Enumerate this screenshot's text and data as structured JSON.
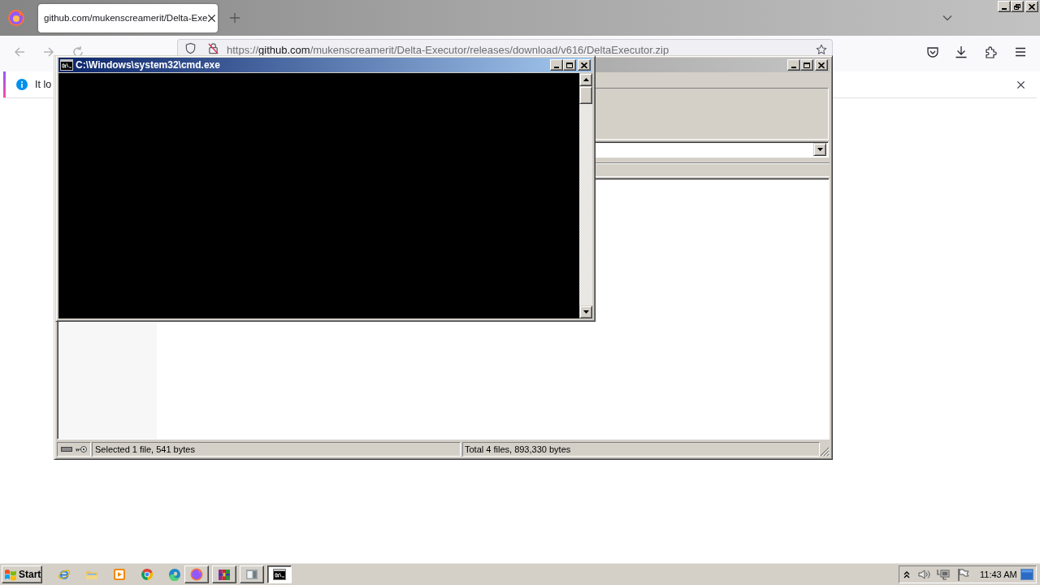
{
  "browser": {
    "tabs": [
      {
        "title": "github.com/mukenscreamerit/Delta-Exe",
        "selected": true
      }
    ],
    "url": {
      "scheme": "https://",
      "host": "github.com",
      "path": "/mukenscreamerit/Delta-Executor/releases/download/v616/DeltaExecutor.zip"
    },
    "notification": {
      "text": "It lo"
    }
  },
  "windows": [
    {
      "kind": "console",
      "active": true,
      "title": "C:\\Windows\\system32\\cmd.exe"
    },
    {
      "kind": "archive",
      "active": false,
      "status": [
        "Selected 1 file, 541 bytes",
        "Total 4 files, 893,330 bytes"
      ]
    }
  ],
  "taskbar": {
    "start": "Start",
    "tasks": [
      {
        "kind": "browser",
        "selected": false
      },
      {
        "kind": "archive",
        "selected": false
      },
      {
        "kind": "app",
        "selected": false
      },
      {
        "kind": "console",
        "selected": true
      }
    ],
    "clock": "11:43 AM"
  }
}
